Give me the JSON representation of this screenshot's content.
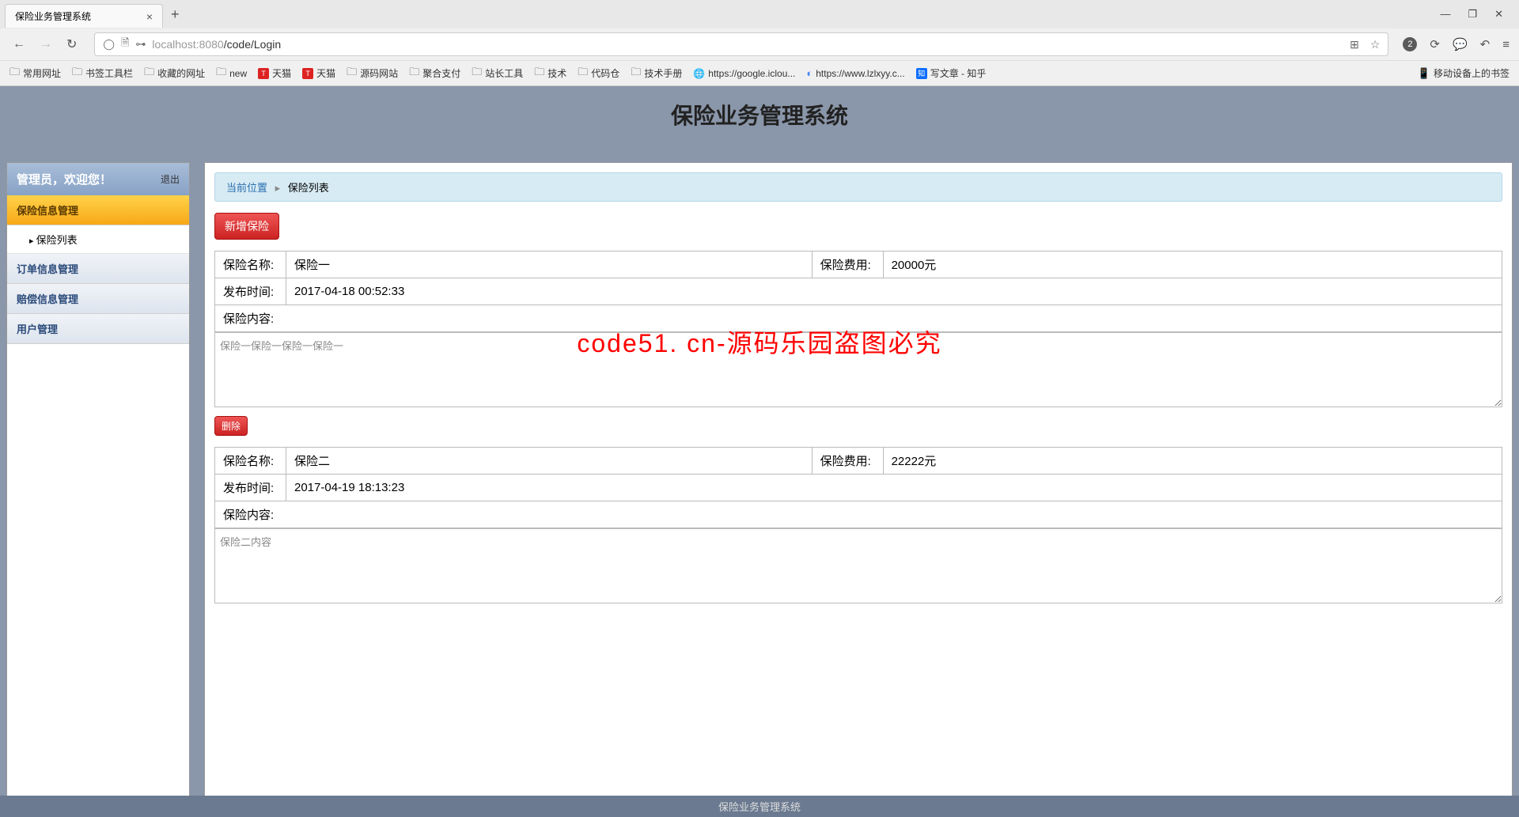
{
  "browser": {
    "tab_title": "保险业务管理系统",
    "url_host": "localhost",
    "url_port": ":8080",
    "url_path": "/code/Login",
    "badge_count": "2",
    "bookmarks": [
      "常用网址",
      "书签工具栏",
      "收藏的网址",
      "new",
      "天猫",
      "天猫",
      "源码网站",
      "聚合支付",
      "站长工具",
      "技术",
      "代码仓",
      "技术手册",
      "https://google.iclou...",
      "https://www.lzlxyy.c...",
      "写文章 - 知乎"
    ],
    "bookmark_right": "移动设备上的书签"
  },
  "page": {
    "title": "保险业务管理系统",
    "footer": "保险业务管理系统"
  },
  "sidebar": {
    "welcome": "管理员，欢迎您！",
    "logout": "退出",
    "items": [
      {
        "label": "保险信息管理",
        "active": true
      },
      {
        "label": "保险列表",
        "sub": true
      },
      {
        "label": "订单信息管理"
      },
      {
        "label": "赔偿信息管理"
      },
      {
        "label": "用户管理"
      }
    ]
  },
  "breadcrumb": {
    "current_label": "当前位置",
    "page": "保险列表"
  },
  "buttons": {
    "add": "新增保险",
    "delete": "删除"
  },
  "labels": {
    "name": "保险名称:",
    "fee": "保险费用:",
    "publish": "发布时间:",
    "content": "保险内容:"
  },
  "records": [
    {
      "name": "保险一",
      "fee": "20000元",
      "publish": "2017-04-18 00:52:33",
      "content": "保险一保险一保险一保险一"
    },
    {
      "name": "保险二",
      "fee": "22222元",
      "publish": "2017-04-19 18:13:23",
      "content": "保险二内容"
    }
  ],
  "watermark": "code51. cn-源码乐园盗图必究"
}
